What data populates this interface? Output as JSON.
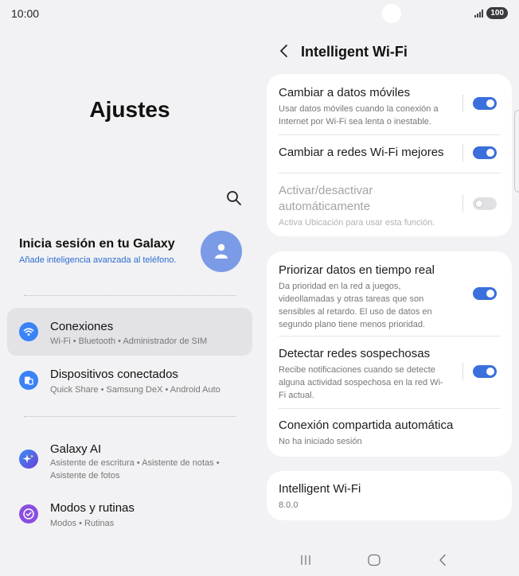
{
  "status": {
    "time": "10:00",
    "battery": "100"
  },
  "left": {
    "title": "Ajustes",
    "account": {
      "title": "Inicia sesión en tu Galaxy",
      "subtitle": "Añade inteligencia avanzada al teléfono."
    },
    "items": [
      {
        "title": "Conexiones",
        "subtitle": "Wi-Fi • Bluetooth • Administrador de SIM",
        "icon": "wifi-icon",
        "color": "#3a82f7"
      },
      {
        "title": "Dispositivos conectados",
        "subtitle": "Quick Share • Samsung DeX • Android Auto",
        "icon": "devices-icon",
        "color": "#3a82f7"
      },
      {
        "title": "Galaxy AI",
        "subtitle": "Asistente de escritura • Asistente de notas • Asistente de fotos",
        "icon": "sparkle-icon",
        "color": "#5b3fd6"
      },
      {
        "title": "Modos y rutinas",
        "subtitle": "Modos • Rutinas",
        "icon": "check-circle-icon",
        "color": "#8a4ee0"
      }
    ]
  },
  "right": {
    "title": "Intelligent Wi-Fi",
    "card1": [
      {
        "title": "Cambiar a datos móviles",
        "desc": "Usar datos móviles cuando la conexión a Internet por Wi-Fi sea lenta o inestable.",
        "on": true
      },
      {
        "title": "Cambiar a redes Wi-Fi mejores",
        "desc": "",
        "on": true
      },
      {
        "title": "Activar/desactivar automáticamente",
        "desc": "Activa Ubicación para usar esta función.",
        "on": false,
        "disabled": true
      }
    ],
    "card2": [
      {
        "title": "Priorizar datos en tiempo real",
        "desc": "Da prioridad en la red a juegos, videollamadas y otras tareas que son sensibles al retardo. El uso de datos en segundo plano tiene menos prioridad.",
        "on": true
      },
      {
        "title": "Detectar redes sospechosas",
        "desc": "Recibe notificaciones cuando se detecte alguna actividad sospechosa en la red Wi-Fi actual.",
        "on": true
      },
      {
        "title": "Conexión compartida automática",
        "desc": "No ha iniciado sesión"
      }
    ],
    "card3": {
      "title": "Intelligent Wi-Fi",
      "version": "8.0.0"
    }
  },
  "colors": {
    "accent": "#3a6fdc",
    "background": "#f2f2f4"
  }
}
